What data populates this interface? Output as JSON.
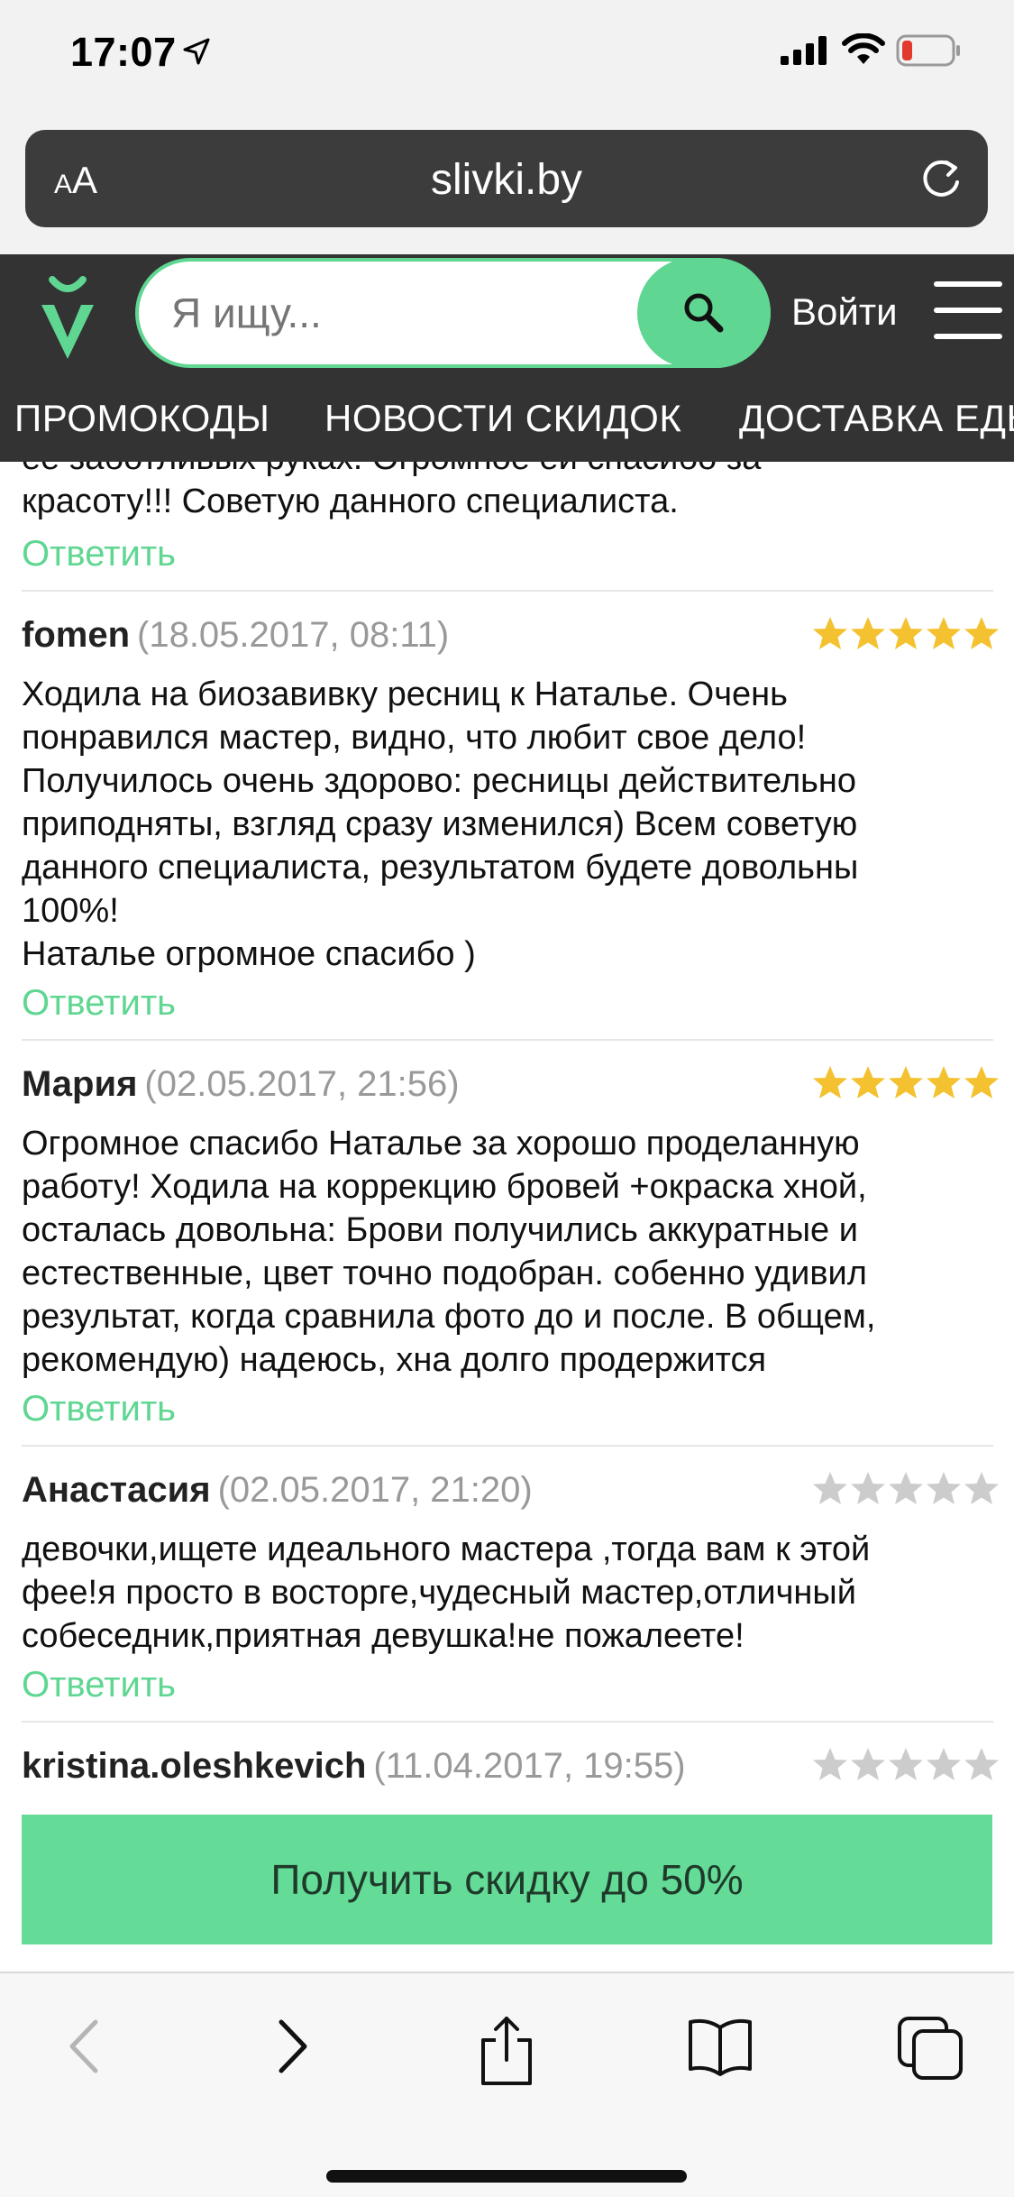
{
  "status": {
    "time": "17:07"
  },
  "browser": {
    "aa": "AA",
    "url": "slivki.by"
  },
  "header": {
    "search_placeholder": "Я ищу...",
    "login": "Войти",
    "nav": [
      "ПРОМОКОДЫ",
      "НОВОСТИ СКИДОК",
      "ДОСТАВКА ЕДЫ"
    ]
  },
  "colors": {
    "accent": "#5fd691",
    "star_active": "#f4c230",
    "star_inactive": "#cccccc",
    "header_bg": "#333333"
  },
  "partial_review": {
    "text_top": "ее заботливых руках. Огромное ей спасибо за",
    "text": "красоту!!! Советую данного специалиста.",
    "reply": "Ответить"
  },
  "reviews": [
    {
      "author": "fomen",
      "date": "(18.05.2017, 08:11)",
      "rating": 5,
      "text": [
        "Ходила на биозавивку ресниц к Наталье. Очень",
        "понравился мастер, видно, что любит свое дело!",
        "Получилось очень здорово: ресницы действительно",
        "приподняты, взгляд сразу изменился) Всем советую",
        "данного специалиста, результатом будете довольны",
        "100%!",
        "Наталье огромное спасибо )"
      ],
      "reply": "Ответить"
    },
    {
      "author": "Мария",
      "date": "(02.05.2017, 21:56)",
      "rating": 5,
      "text": [
        "Огромное спасибо Наталье за хорошо проделанную",
        "работу! Ходила на коррекцию бровей +окраска хной,",
        "осталась довольна: Брови получились аккуратные и",
        "естественные, цвет точно подобран. собенно удивил",
        "результат, когда сравнила фото до и после. В общем,",
        "рекомендую) надеюсь, хна долго продержится"
      ],
      "reply": "Ответить"
    },
    {
      "author": "Анастасия",
      "date": "(02.05.2017, 21:20)",
      "rating": 0,
      "text": [
        "девочки,ищете идеального мастера ,тогда вам к этой",
        "фее!я просто в восторге,чудесный мастер,отличный",
        "собеседник,приятная девушка!не пожалеете!"
      ],
      "reply": "Ответить"
    },
    {
      "author": "kristina.oleshkevich",
      "date": "(11.04.2017, 19:55)",
      "rating": 0,
      "text": [],
      "reply": ""
    }
  ],
  "cta": {
    "label": "Получить скидку до 50%"
  }
}
